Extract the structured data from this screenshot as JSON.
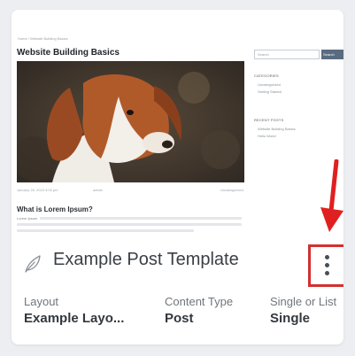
{
  "preview": {
    "breadcrumb": "Home  /  Website Building Basics",
    "post_title": "Website Building Basics",
    "meta": {
      "date": "January 26, 2023 3:00 pm",
      "author": "admin",
      "category": "Uncategorized"
    },
    "subheading": "What is Lorem Ipsum?",
    "lorem_lead": "Lorem Ipsum",
    "sidebar": {
      "search_placeholder": "Search",
      "search_button": "Search",
      "categories_heading": "CATEGORIES",
      "categories": [
        "Uncategorized",
        "Getting Started"
      ],
      "recent_heading": "RECENT POSTS",
      "recent": [
        "Website Building Basics",
        "Hello World"
      ]
    }
  },
  "card": {
    "title": "Example Post Template",
    "icon": "feather-icon",
    "menu_icon": "vertical-dots-icon",
    "columns": [
      {
        "label": "Layout",
        "value": "Example Layo..."
      },
      {
        "label": "Content Type",
        "value": "Post"
      },
      {
        "label": "Single or List",
        "value": "Single"
      }
    ]
  },
  "annotation": {
    "arrow_color": "#e02020",
    "highlight_color": "#d32f2f"
  }
}
